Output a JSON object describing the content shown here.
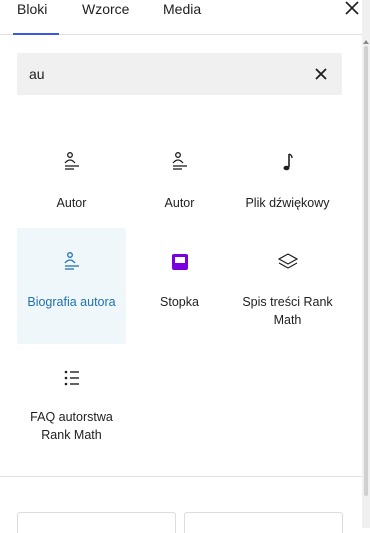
{
  "tabs": [
    {
      "label": "Bloki",
      "active": true
    },
    {
      "label": "Wzorce",
      "active": false
    },
    {
      "label": "Media",
      "active": false
    }
  ],
  "close_icon": "close-icon",
  "search": {
    "value": "au",
    "clear_icon": "clear-icon"
  },
  "blocks": [
    {
      "label": "Autor",
      "icon": "author-icon"
    },
    {
      "label": "Autor",
      "icon": "author-icon"
    },
    {
      "label": "Plik dźwiękowy",
      "icon": "audio-note-icon"
    },
    {
      "label": "Biografia autora",
      "icon": "author-bio-icon",
      "selected": true
    },
    {
      "label": "Stopka",
      "icon": "footer-template-icon"
    },
    {
      "label": "Spis treści Rank Math",
      "icon": "table-of-contents-icon"
    },
    {
      "label": "FAQ autorstwa Rank Math",
      "icon": "faq-list-icon"
    }
  ],
  "colors": {
    "accent": "#3858e9",
    "selected_text": "#2271b1",
    "selected_bg": "#f0f7fb",
    "footer_icon": "#7a00df"
  }
}
